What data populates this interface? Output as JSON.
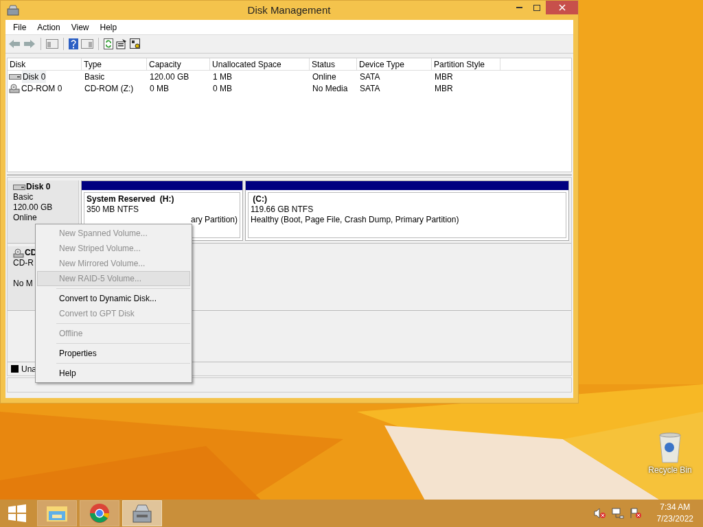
{
  "window": {
    "title": "Disk Management"
  },
  "menu": [
    "File",
    "Action",
    "View",
    "Help"
  ],
  "table": {
    "columns": [
      "Disk",
      "Type",
      "Capacity",
      "Unallocated Space",
      "Status",
      "Device Type",
      "Partition Style"
    ],
    "rows": [
      {
        "kind": "hdd",
        "selected": true,
        "cells": [
          "Disk 0",
          "Basic",
          "120.00 GB",
          "1 MB",
          "Online",
          "SATA",
          "MBR"
        ]
      },
      {
        "kind": "cdrom",
        "selected": false,
        "cells": [
          "CD-ROM 0",
          "CD-ROM (Z:)",
          "0 MB",
          "0 MB",
          "No Media",
          "SATA",
          "MBR"
        ]
      }
    ]
  },
  "disks": [
    {
      "kind": "hdd",
      "name": "Disk 0",
      "lines": [
        "Basic",
        "120.00 GB",
        "Online"
      ],
      "partitions": [
        {
          "name": "System Reserved  (H:)",
          "size": "350 MB NTFS",
          "status": "ary Partition)"
        },
        {
          "name": " (C:)",
          "size": "119.66 GB NTFS",
          "status": "Healthy (Boot, Page File, Crash Dump, Primary Partition)"
        }
      ]
    },
    {
      "kind": "cdrom",
      "name": "CD",
      "lines": [
        "CD-R",
        "No M"
      ]
    }
  ],
  "legend": [
    {
      "label": "Una",
      "color": "#000000"
    }
  ],
  "context_menu": [
    {
      "kind": "item",
      "label": "New Spanned Volume...",
      "disabled": true,
      "selected": false
    },
    {
      "kind": "item",
      "label": "New Striped Volume...",
      "disabled": true,
      "selected": false
    },
    {
      "kind": "item",
      "label": "New Mirrored Volume...",
      "disabled": true,
      "selected": false
    },
    {
      "kind": "item",
      "label": "New RAID-5 Volume...",
      "disabled": true,
      "selected": true
    },
    {
      "kind": "separator"
    },
    {
      "kind": "item",
      "label": "Convert to Dynamic Disk...",
      "disabled": false,
      "selected": false
    },
    {
      "kind": "item",
      "label": "Convert to GPT Disk",
      "disabled": true,
      "selected": false
    },
    {
      "kind": "separator"
    },
    {
      "kind": "item",
      "label": "Offline",
      "disabled": true,
      "selected": false
    },
    {
      "kind": "separator"
    },
    {
      "kind": "item",
      "label": "Properties",
      "disabled": false,
      "selected": false
    },
    {
      "kind": "separator"
    },
    {
      "kind": "item",
      "label": "Help",
      "disabled": false,
      "selected": false
    }
  ],
  "desktop": {
    "icons": [
      {
        "label": "Recycle Bin"
      }
    ]
  },
  "taskbar": {
    "apps": [
      {
        "kind": "explorer",
        "selected": false
      },
      {
        "kind": "chrome",
        "selected": false
      },
      {
        "kind": "diskmgmt",
        "selected": true
      }
    ],
    "clock": {
      "time": "7:34 AM",
      "date": "7/23/2022"
    }
  }
}
